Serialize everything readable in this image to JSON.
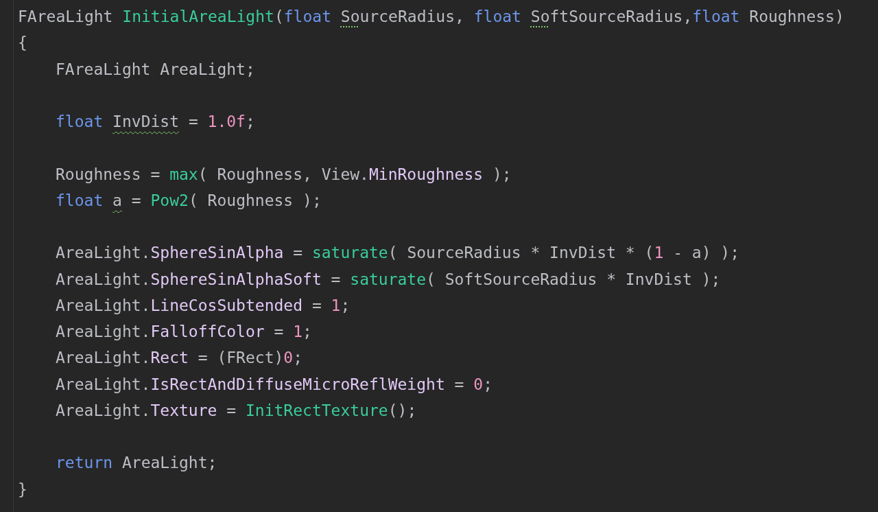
{
  "editor": {
    "lines": [
      {
        "kind": "code",
        "tokens": [
          {
            "text": "FAreaLight ",
            "kind": "plain"
          },
          {
            "text": "InitialAreaLight",
            "kind": "function"
          },
          {
            "text": "(",
            "kind": "plain"
          },
          {
            "text": "float ",
            "kind": "keyword"
          },
          {
            "text": "So",
            "kind": "hint"
          },
          {
            "text": "urceRadius, ",
            "kind": "plain"
          },
          {
            "text": "float ",
            "kind": "keyword"
          },
          {
            "text": "So",
            "kind": "hint"
          },
          {
            "text": "ftSourceRadius,",
            "kind": "plain"
          },
          {
            "text": "float",
            "kind": "keyword"
          },
          {
            "text": " Roughness)",
            "kind": "plain"
          }
        ]
      },
      {
        "kind": "code",
        "tokens": [
          {
            "text": "{",
            "kind": "plain"
          }
        ]
      },
      {
        "kind": "block",
        "lines": [
          {
            "kind": "code",
            "tokens": [
              {
                "text": "FAreaLight AreaLight;",
                "kind": "plain"
              }
            ]
          },
          {
            "kind": "blank"
          },
          {
            "kind": "code",
            "tokens": [
              {
                "text": "float ",
                "kind": "keyword"
              },
              {
                "text": "InvDist",
                "kind": "warning"
              },
              {
                "text": " = ",
                "kind": "plain"
              },
              {
                "text": "1.0f",
                "kind": "number"
              },
              {
                "text": ";",
                "kind": "plain"
              }
            ]
          },
          {
            "kind": "blank"
          },
          {
            "kind": "code",
            "tokens": [
              {
                "text": "Roughness = ",
                "kind": "plain"
              },
              {
                "text": "max",
                "kind": "function"
              },
              {
                "text": "( Roughness, View.",
                "kind": "plain"
              },
              {
                "text": "MinRoughness",
                "kind": "field"
              },
              {
                "text": " );",
                "kind": "plain"
              }
            ]
          },
          {
            "kind": "code",
            "tokens": [
              {
                "text": "float ",
                "kind": "keyword"
              },
              {
                "text": "a",
                "kind": "warning"
              },
              {
                "text": " = ",
                "kind": "plain"
              },
              {
                "text": "Pow2",
                "kind": "function"
              },
              {
                "text": "( Roughness );",
                "kind": "plain"
              }
            ]
          },
          {
            "kind": "blank"
          },
          {
            "kind": "code",
            "tokens": [
              {
                "text": "AreaLight.",
                "kind": "plain"
              },
              {
                "text": "SphereSinAlpha",
                "kind": "field"
              },
              {
                "text": " = ",
                "kind": "plain"
              },
              {
                "text": "saturate",
                "kind": "function"
              },
              {
                "text": "( SourceRadius * InvDist * (",
                "kind": "plain"
              },
              {
                "text": "1",
                "kind": "number"
              },
              {
                "text": " - a) );",
                "kind": "plain"
              }
            ]
          },
          {
            "kind": "code",
            "tokens": [
              {
                "text": "AreaLight.",
                "kind": "plain"
              },
              {
                "text": "SphereSinAlphaSoft",
                "kind": "field"
              },
              {
                "text": " = ",
                "kind": "plain"
              },
              {
                "text": "saturate",
                "kind": "function"
              },
              {
                "text": "( SoftSourceRadius * InvDist );",
                "kind": "plain"
              }
            ]
          },
          {
            "kind": "code",
            "tokens": [
              {
                "text": "AreaLight.",
                "kind": "plain"
              },
              {
                "text": "LineCosSubtended",
                "kind": "field"
              },
              {
                "text": " = ",
                "kind": "plain"
              },
              {
                "text": "1",
                "kind": "number"
              },
              {
                "text": ";",
                "kind": "plain"
              }
            ]
          },
          {
            "kind": "code",
            "tokens": [
              {
                "text": "AreaLight.",
                "kind": "plain"
              },
              {
                "text": "FalloffColor",
                "kind": "field"
              },
              {
                "text": " = ",
                "kind": "plain"
              },
              {
                "text": "1",
                "kind": "number"
              },
              {
                "text": ";",
                "kind": "plain"
              }
            ]
          },
          {
            "kind": "code",
            "tokens": [
              {
                "text": "AreaLight.",
                "kind": "plain"
              },
              {
                "text": "Rect",
                "kind": "field"
              },
              {
                "text": " = (FRect)",
                "kind": "plain"
              },
              {
                "text": "0",
                "kind": "number"
              },
              {
                "text": ";",
                "kind": "plain"
              }
            ]
          },
          {
            "kind": "code",
            "tokens": [
              {
                "text": "AreaLight.",
                "kind": "plain"
              },
              {
                "text": "IsRectAndDiffuseMicroReflWeight",
                "kind": "field"
              },
              {
                "text": " = ",
                "kind": "plain"
              },
              {
                "text": "0",
                "kind": "number"
              },
              {
                "text": ";",
                "kind": "plain"
              }
            ]
          },
          {
            "kind": "code",
            "tokens": [
              {
                "text": "AreaLight.",
                "kind": "plain"
              },
              {
                "text": "Texture",
                "kind": "field"
              },
              {
                "text": " = ",
                "kind": "plain"
              },
              {
                "text": "InitRectTexture",
                "kind": "function"
              },
              {
                "text": "();",
                "kind": "plain"
              }
            ]
          },
          {
            "kind": "blank"
          },
          {
            "kind": "code",
            "tokens": [
              {
                "text": "return",
                "kind": "keyword"
              },
              {
                "text": " AreaLight;",
                "kind": "plain"
              }
            ]
          }
        ]
      },
      {
        "kind": "code",
        "tokens": [
          {
            "text": "}",
            "kind": "plain"
          }
        ]
      }
    ]
  }
}
